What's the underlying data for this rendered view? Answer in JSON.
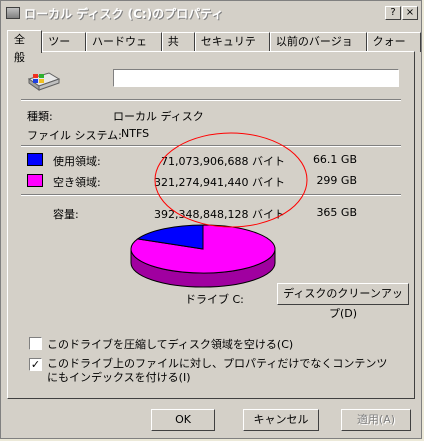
{
  "window": {
    "title": "ローカル ディスク (C:)のプロパティ",
    "help_glyph": "?",
    "close_glyph": "×"
  },
  "tabs": [
    {
      "label": "全般"
    },
    {
      "label": "ツール"
    },
    {
      "label": "ハードウェア"
    },
    {
      "label": "共有"
    },
    {
      "label": "セキュリティ"
    },
    {
      "label": "以前のバージョン"
    },
    {
      "label": "クォータ"
    }
  ],
  "drive": {
    "name_value": "",
    "type_label": "種類:",
    "type_value": "ローカル ディスク",
    "fs_label": "ファイル システム:",
    "fs_value": "NTFS"
  },
  "usage": {
    "used": {
      "label": "使用領域:",
      "bytes": "71,073,906,688 バイト",
      "size": "66.1 GB",
      "color": "#0000ff"
    },
    "free": {
      "label": "空き領域:",
      "bytes": "321,274,941,440 バイト",
      "size": "299 GB",
      "color": "#ff00ff"
    },
    "capacity": {
      "label": "容量:",
      "bytes": "392,348,848,128 バイト",
      "size": "365 GB"
    },
    "used_fraction": 0.1811
  },
  "drive_label": "ドライブ C:",
  "cleanup_button": "ディスクのクリーンアップ(D)",
  "options": {
    "compress": {
      "label": "このドライブを圧縮してディスク領域を空ける(C)",
      "checked": false
    },
    "index": {
      "label": "このドライブ上のファイルに対し、プロパティだけでなくコンテンツにもインデックスを付ける(I)",
      "checked": true
    }
  },
  "footer": {
    "ok": "OK",
    "cancel": "キャンセル",
    "apply": "適用(A)"
  },
  "annotation": {
    "color": "#ff0000"
  }
}
